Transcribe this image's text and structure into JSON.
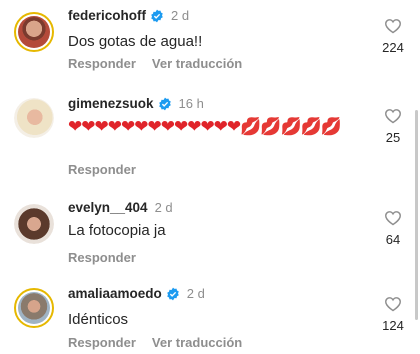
{
  "comments": [
    {
      "username": "federicohoff",
      "verified": true,
      "time": "2 d",
      "text": "Dos  gotas de agua!!",
      "likes": "224",
      "reply_label": "Responder",
      "translate_label": "Ver traducción"
    },
    {
      "username": "gimenezsuok",
      "verified": true,
      "time": "16 h",
      "text_emojis": "❤❤❤❤❤❤❤❤❤❤❤❤❤💋💋💋💋💋",
      "likes": "25",
      "reply_label": "Responder"
    },
    {
      "username": "evelyn__404",
      "verified": false,
      "time": "2 d",
      "text": "La fotocopia ja",
      "likes": "64",
      "reply_label": "Responder"
    },
    {
      "username": "amaliaamoedo",
      "verified": true,
      "time": "2 d",
      "text": "Idénticos",
      "likes": "124",
      "reply_label": "Responder",
      "translate_label": "Ver traducción"
    }
  ],
  "icons": {
    "verified": "verified-badge-icon",
    "like": "heart-outline-icon"
  },
  "colors": {
    "verified_blue": "#1d9bf0",
    "text": "#262626",
    "secondary": "#8e8e8e",
    "heart": "#e0242a",
    "story_ring": "#e6b800"
  }
}
